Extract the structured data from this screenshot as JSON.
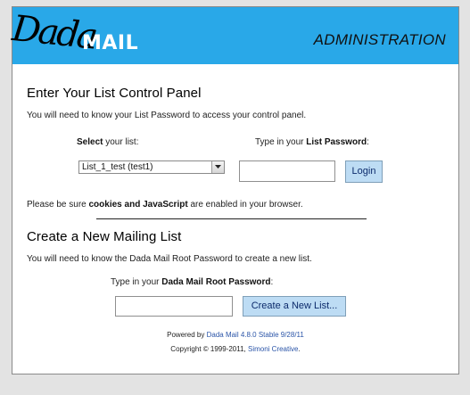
{
  "header": {
    "logo_part1": "Dada",
    "logo_part2": "MAIL",
    "title": "ADMINISTRATION"
  },
  "control_panel": {
    "heading": "Enter Your List Control Panel",
    "intro": "You will need to know your List Password to access your control panel.",
    "select_label_bold": "Select",
    "select_label_rest": " your list:",
    "select_value": "List_1_test (test1)",
    "password_label_pre": "Type in your ",
    "password_label_bold": "List Password",
    "password_label_post": ":",
    "password_value": "",
    "login_button": "Login",
    "cookies_pre": "Please be sure ",
    "cookies_bold": "cookies and JavaScript",
    "cookies_post": " are enabled in your browser."
  },
  "create_list": {
    "heading": "Create a New Mailing List",
    "intro": "You will need to know the Dada Mail Root Password to create a new list.",
    "root_label_pre": "Type in your ",
    "root_label_bold": "Dada Mail Root Password",
    "root_label_post": ":",
    "root_password_value": "",
    "create_button": "Create a New List..."
  },
  "footer": {
    "powered_pre": "Powered by ",
    "powered_link": "Dada Mail 4.8.0 Stable 9/28/11",
    "copyright_pre": "Copyright © 1999-2011, ",
    "copyright_link": "Simoni Creative",
    "copyright_post": "."
  },
  "colors": {
    "header_bg": "#29a8e8",
    "button_bg": "#bddcf4",
    "link": "#2b55a8"
  }
}
